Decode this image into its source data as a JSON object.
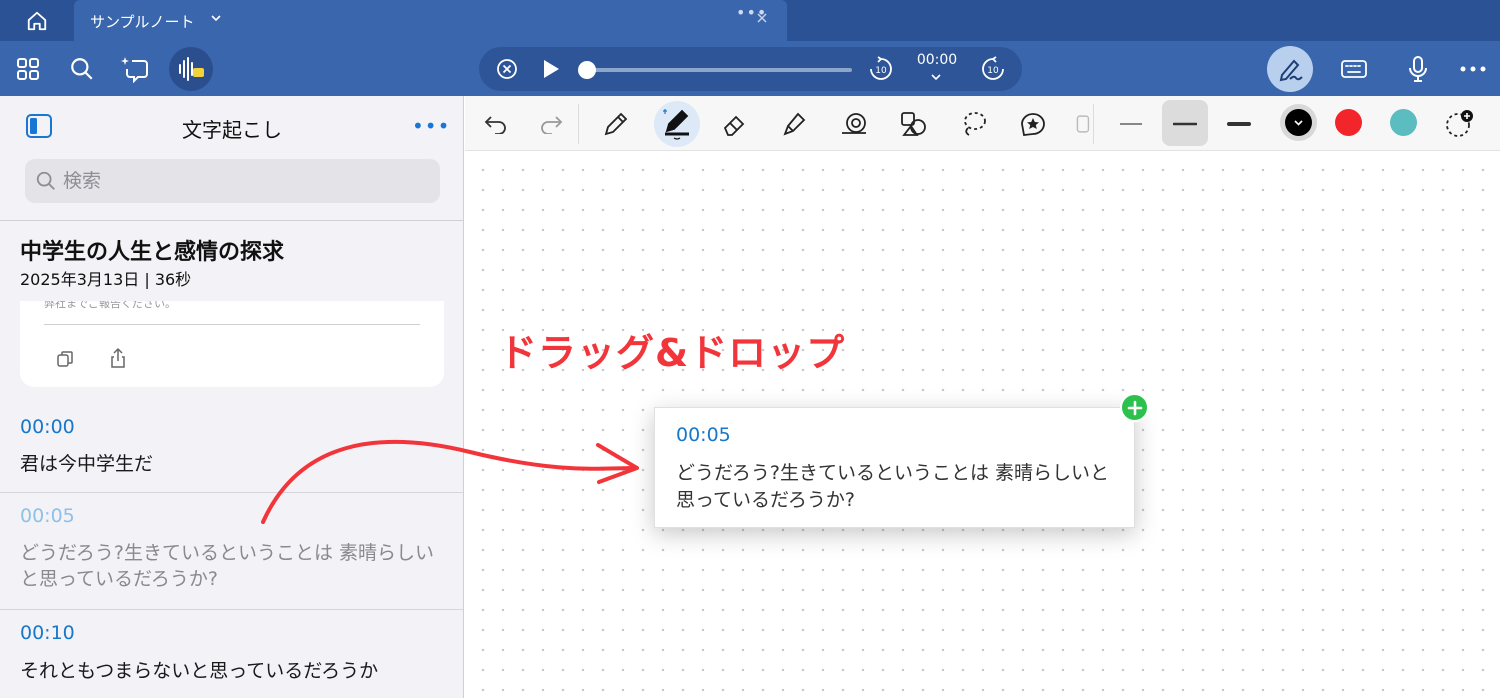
{
  "tabbar": {
    "home_icon": "home-icon",
    "tab_title": "サンプルノート",
    "tab_menu_dots": "•••"
  },
  "toolbar": {
    "icons": [
      "grid-icon",
      "search-icon",
      "ai-sparkle-icon",
      "transcription-icon"
    ],
    "player": {
      "time": "00:00",
      "progress": 0,
      "rewind_seconds": "10",
      "forward_seconds": "10"
    },
    "right_icons": [
      "pen-mode-icon",
      "keyboard-icon",
      "microphone-icon",
      "more-icon"
    ]
  },
  "sidebar": {
    "title": "文字起こし",
    "more": "•••",
    "search_placeholder": "検索",
    "note_title": "中学生の人生と感情の探求",
    "note_meta": "2025年3月13日 | 36秒",
    "summary_clip": "弊社までご報告ください。",
    "segments": [
      {
        "time": "00:00",
        "text": "君は今中学生だ"
      },
      {
        "time": "00:05",
        "text": "どうだろう?生きているということは 素晴らしいと思っているだろうか?"
      },
      {
        "time": "00:10",
        "text": "それともつまらないと思っているだろうか"
      }
    ]
  },
  "drawbar": {
    "tools": [
      "undo",
      "redo",
      "pencil",
      "pen",
      "eraser",
      "highlighter",
      "shape-lasso",
      "shapes",
      "lasso",
      "sticker"
    ],
    "selected_tool": "pen",
    "selected_stroke": "medium",
    "colors": {
      "black": "#000000",
      "red": "#f2262a",
      "teal": "#5bbdbf"
    }
  },
  "canvas": {
    "annotation": "ドラッグ&ドロップ",
    "annotation_color": "#f2353a",
    "card": {
      "time": "00:05",
      "text": "どうだろう?生きているということは 素晴らしいと思っているだろうか?"
    }
  }
}
